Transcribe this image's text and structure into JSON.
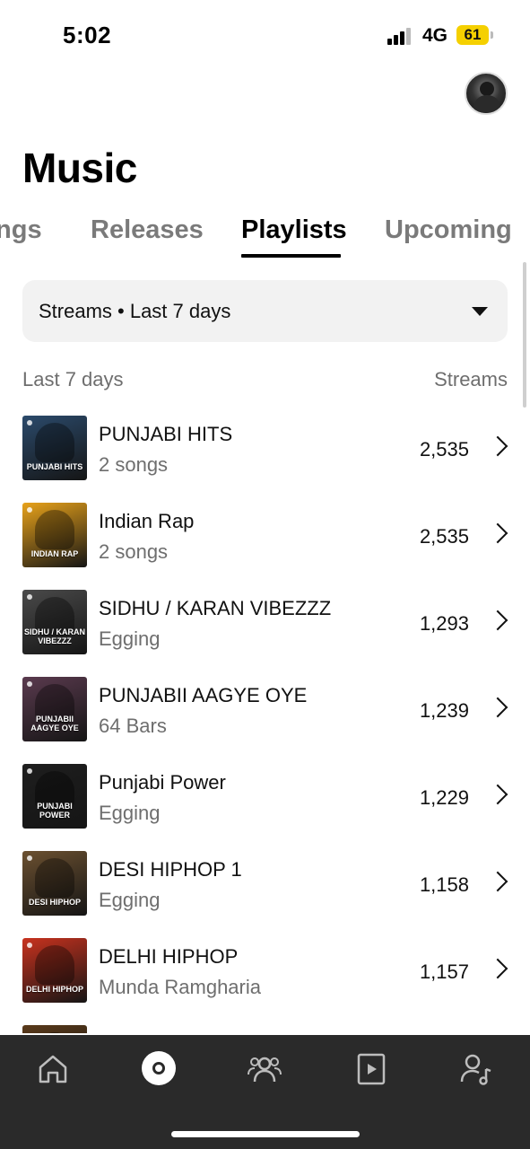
{
  "status_bar": {
    "time": "5:02",
    "network": "4G",
    "battery": "61",
    "battery_color": "#f5d000"
  },
  "header": {
    "title": "Music",
    "avatar_icon": "profile-avatar"
  },
  "tabs": [
    {
      "label": "Songs",
      "visible_text": "ongs",
      "active": false
    },
    {
      "label": "Releases",
      "active": false
    },
    {
      "label": "Playlists",
      "active": true
    },
    {
      "label": "Upcoming",
      "active": false
    }
  ],
  "filter": {
    "label": "Streams • Last 7 days",
    "icon": "caret-down-icon"
  },
  "list_header": {
    "left": "Last 7 days",
    "right": "Streams"
  },
  "playlists": [
    {
      "title": "PUNJABI HITS",
      "subtitle": "2 songs",
      "streams": "2,535",
      "cover_text": "PUNJABI HITS",
      "cover_color": "#2b4a6b"
    },
    {
      "title": "Indian Rap",
      "subtitle": "2 songs",
      "streams": "2,535",
      "cover_text": "INDIAN RAP",
      "cover_color": "#e8a21a"
    },
    {
      "title": "SIDHU / KARAN VIBEZZZ",
      "subtitle": "Egging",
      "streams": "1,293",
      "cover_text": "SIDHU / KARAN VIBEZZZ",
      "cover_color": "#4a4a4a"
    },
    {
      "title": "PUNJABII AAGYE OYE",
      "subtitle": "64 Bars",
      "streams": "1,239",
      "cover_text": "PUNJABII AAGYE OYE",
      "cover_color": "#5a3a4e"
    },
    {
      "title": "Punjabi Power",
      "subtitle": "Egging",
      "streams": "1,229",
      "cover_text": "PUNJABI POWER",
      "cover_color": "#1e1e1e"
    },
    {
      "title": "DESI HIPHOP 1",
      "subtitle": "Egging",
      "streams": "1,158",
      "cover_text": "DESI HIPHOP",
      "cover_color": "#6b5030"
    },
    {
      "title": "DELHI HIPHOP",
      "subtitle": "Munda Ramgharia",
      "streams": "1,157",
      "cover_text": "DELHI HIPHOP",
      "cover_color": "#c8321e"
    },
    {
      "title": "",
      "subtitle": "",
      "streams": "",
      "cover_text": "",
      "cover_color": "#5a3a1a"
    }
  ],
  "bottom_nav": [
    {
      "name": "home",
      "icon": "home-icon"
    },
    {
      "name": "music",
      "icon": "music-disc-icon",
      "active": true
    },
    {
      "name": "audience",
      "icon": "audience-icon"
    },
    {
      "name": "video",
      "icon": "video-icon"
    },
    {
      "name": "artist",
      "icon": "artist-icon"
    }
  ],
  "colors": {
    "nav_background": "#2a2a2a",
    "tab_inactive": "#7a7a7a",
    "secondary_text": "#6e6e6e",
    "dropdown_background": "#f2f2f2"
  }
}
